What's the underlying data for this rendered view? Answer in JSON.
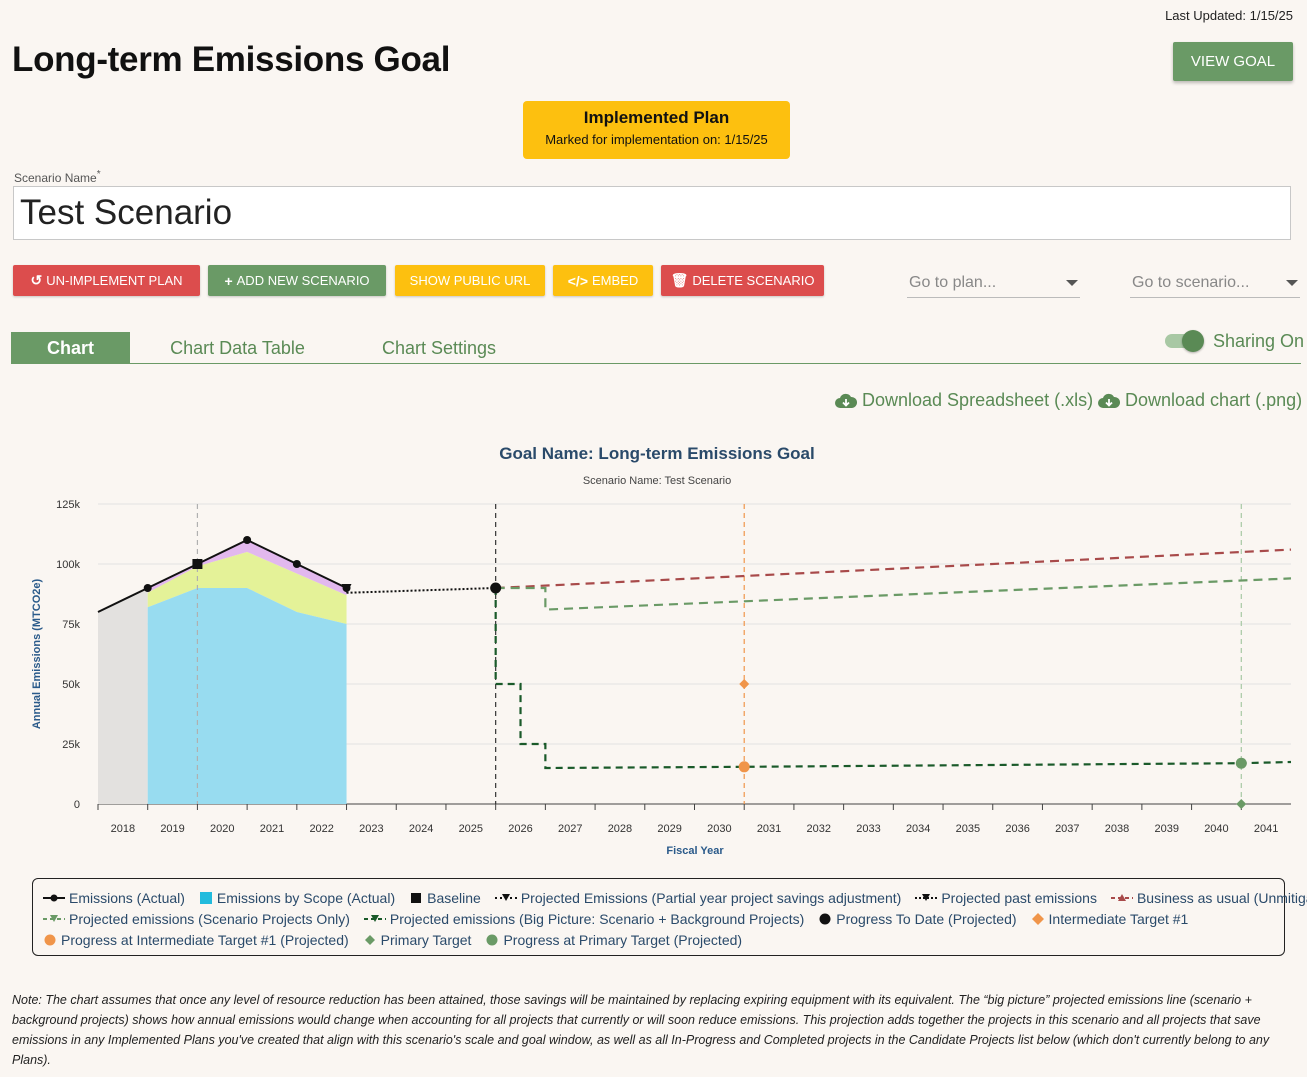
{
  "header": {
    "last_updated": "Last Updated: 1/15/25",
    "title": "Long-term Emissions Goal",
    "view_goal": "VIEW GOAL"
  },
  "plan_badge": {
    "title": "Implemented Plan",
    "subtitle": "Marked for implementation on: 1/15/25"
  },
  "scenario": {
    "label": "Scenario Name",
    "required_mark": "*",
    "value": "Test Scenario"
  },
  "actions": {
    "unimplement": "UN-IMPLEMENT PLAN",
    "add_scenario": "ADD NEW SCENARIO",
    "public_url": "SHOW PUBLIC URL",
    "embed": "EMBED",
    "delete": "DELETE SCENARIO",
    "goto_plan": "Go to plan...",
    "goto_scenario": "Go to scenario..."
  },
  "tabs": [
    "Chart",
    "Chart Data Table",
    "Chart Settings"
  ],
  "sharing": {
    "label": "Sharing On",
    "on": true
  },
  "downloads": {
    "spreadsheet": "Download Spreadsheet (.xls)",
    "chart": "Download chart (.png)"
  },
  "colors": {
    "accent_green": "#6a9a66",
    "red": "#dc4d4d",
    "yellow": "#fdc00f"
  },
  "chart_data": {
    "type": "area",
    "title": "Goal Name: Long-term Emissions Goal",
    "subtitle": "Scenario Name: Test Scenario",
    "xlabel": "Fiscal Year",
    "ylabel": "Annual Emissions (MTCO2e)",
    "ylim": [
      0,
      125000
    ],
    "xlim": [
      2017.5,
      2041.5
    ],
    "yticks": [
      "0",
      "25k",
      "50k",
      "75k",
      "100k",
      "125k"
    ],
    "x": [
      2018,
      2019,
      2020,
      2021,
      2022,
      2023,
      2024,
      2025,
      2026,
      2027,
      2028,
      2029,
      2030,
      2031,
      2032,
      2033,
      2034,
      2035,
      2036,
      2037,
      2038,
      2039,
      2040,
      2041
    ],
    "series": [
      {
        "name": "Emissions (Actual)",
        "points": [
          [
            2017.5,
            80000
          ],
          [
            2018.5,
            90000
          ],
          [
            2019.5,
            100000
          ],
          [
            2020.5,
            110000
          ],
          [
            2021.5,
            100000
          ],
          [
            2022.5,
            90000
          ]
        ]
      },
      {
        "name": "Emissions by Scope (Actual)",
        "scope1": [
          [
            2018.5,
            82000
          ],
          [
            2019.5,
            90000
          ],
          [
            2020.5,
            90000
          ],
          [
            2021.5,
            80000
          ],
          [
            2022.5,
            75000
          ]
        ],
        "scope2": [
          [
            2018.5,
            88000
          ],
          [
            2019.5,
            99000
          ],
          [
            2020.5,
            105000
          ],
          [
            2021.5,
            96000
          ],
          [
            2022.5,
            87000
          ]
        ]
      },
      {
        "name": "Baseline",
        "points": [
          [
            2019.5,
            100000
          ]
        ]
      },
      {
        "name": "Projected Emissions (Partial year project savings adjustment)",
        "points": [
          [
            2022.5,
            90000
          ]
        ]
      },
      {
        "name": "Projected past emissions",
        "points": [
          [
            2022.5,
            88000
          ],
          [
            2025.5,
            90000
          ]
        ]
      },
      {
        "name": "Business as usual (Unmitigated)",
        "points": [
          [
            2025.5,
            90000
          ],
          [
            2041.5,
            106000
          ]
        ]
      },
      {
        "name": "Projected emissions (Scenario Projects Only)",
        "points": [
          [
            2025.5,
            90000
          ],
          [
            2026.5,
            90000
          ],
          [
            2026.5,
            81000
          ],
          [
            2041.5,
            94000
          ]
        ]
      },
      {
        "name": "Projected emissions (Big Picture: Scenario + Background Projects)",
        "points": [
          [
            2025.5,
            90000
          ],
          [
            2025.5,
            50000
          ],
          [
            2026,
            50000
          ],
          [
            2026,
            25000
          ],
          [
            2026.5,
            25000
          ],
          [
            2026.5,
            15000
          ],
          [
            2030.5,
            15500
          ],
          [
            2040.5,
            17000
          ],
          [
            2041.5,
            17500
          ]
        ]
      },
      {
        "name": "Progress To Date (Projected)",
        "points": [
          [
            2025.5,
            90000
          ]
        ]
      },
      {
        "name": "Intermediate Target #1",
        "points": [
          [
            2030.5,
            50000
          ]
        ]
      },
      {
        "name": "Progress at Intermediate Target #1 (Projected)",
        "points": [
          [
            2030.5,
            15500
          ]
        ]
      },
      {
        "name": "Primary Target",
        "points": [
          [
            2040.5,
            0
          ]
        ]
      },
      {
        "name": "Progress at Primary Target (Projected)",
        "points": [
          [
            2040.5,
            17000
          ]
        ]
      }
    ],
    "vlines": [
      2019.5,
      2025.5,
      2030.5,
      2040.5
    ],
    "grid": true,
    "legend_position": "bottom"
  },
  "legend": [
    [
      "Emissions (Actual)",
      "Emissions by Scope (Actual)",
      "Baseline",
      "Projected Emissions (Partial year project savings adjustment)",
      "Projected past emissions",
      "Business as usual (Unmitigated)"
    ],
    [
      "Projected emissions (Scenario Projects Only)",
      "Projected emissions (Big Picture: Scenario + Background Projects)",
      "Progress To Date (Projected)",
      "Intermediate Target #1"
    ],
    [
      "Progress at Intermediate Target #1 (Projected)",
      "Primary Target",
      "Progress at Primary Target (Projected)"
    ]
  ],
  "note": "Note: The chart assumes that once any level of resource reduction has been attained, those savings will be maintained by replacing expiring equipment with its equivalent. The “big picture” projected emissions line (scenario + background projects) shows how annual emissions would change when accounting for all projects that currently or will soon reduce emissions. This projection adds together the projects in this scenario and all projects that save emissions in any Implemented Plans you've created that align with this scenario's scale and goal window, as well as all In-Progress and Completed projects in the Candidate Projects list below (which don't currently belong to any Plans)."
}
